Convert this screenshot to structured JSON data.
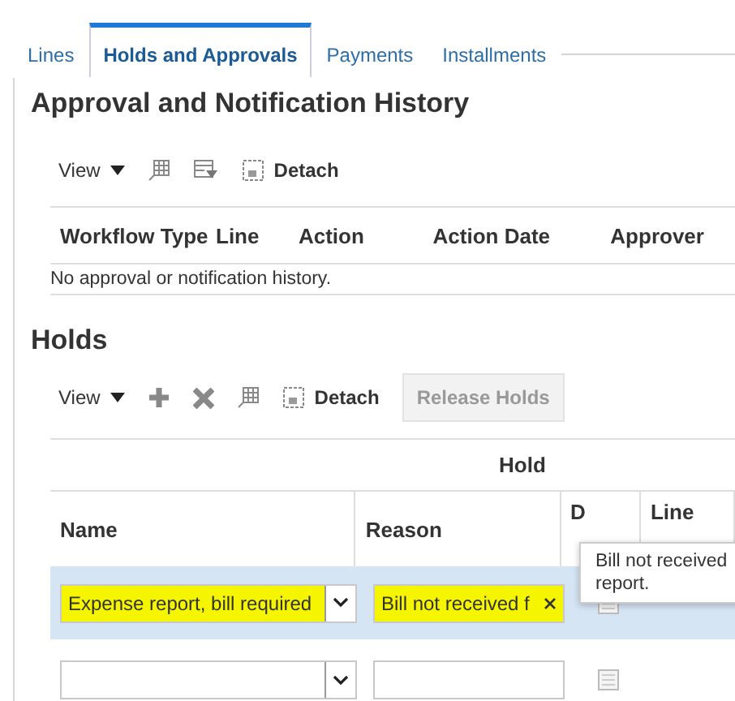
{
  "tabs": [
    {
      "label": "Lines",
      "selected": false
    },
    {
      "label": "Holds and Approvals",
      "selected": true
    },
    {
      "label": "Payments",
      "selected": false
    },
    {
      "label": "Installments",
      "selected": false
    }
  ],
  "approval_history": {
    "title": "Approval and Notification History",
    "toolbar": {
      "view": "View",
      "detach": "Detach"
    },
    "columns": [
      "Workflow Type",
      "Line",
      "Action",
      "Action Date",
      "Approver"
    ],
    "empty_message": "No approval or notification history."
  },
  "holds": {
    "title": "Holds",
    "toolbar": {
      "view": "View",
      "detach": "Detach",
      "release": "Release Holds",
      "release_disabled": true
    },
    "group_header": "Hold",
    "columns": [
      "Name",
      "Reason",
      "D",
      "Line"
    ],
    "rows": [
      {
        "name": "Expense report, bill required",
        "reason": "Bill not received f",
        "selected": true,
        "highlighted": true
      },
      {
        "name": "",
        "reason": "",
        "selected": false,
        "highlighted": false
      }
    ],
    "tooltip": [
      "Bill not received",
      "report."
    ]
  }
}
